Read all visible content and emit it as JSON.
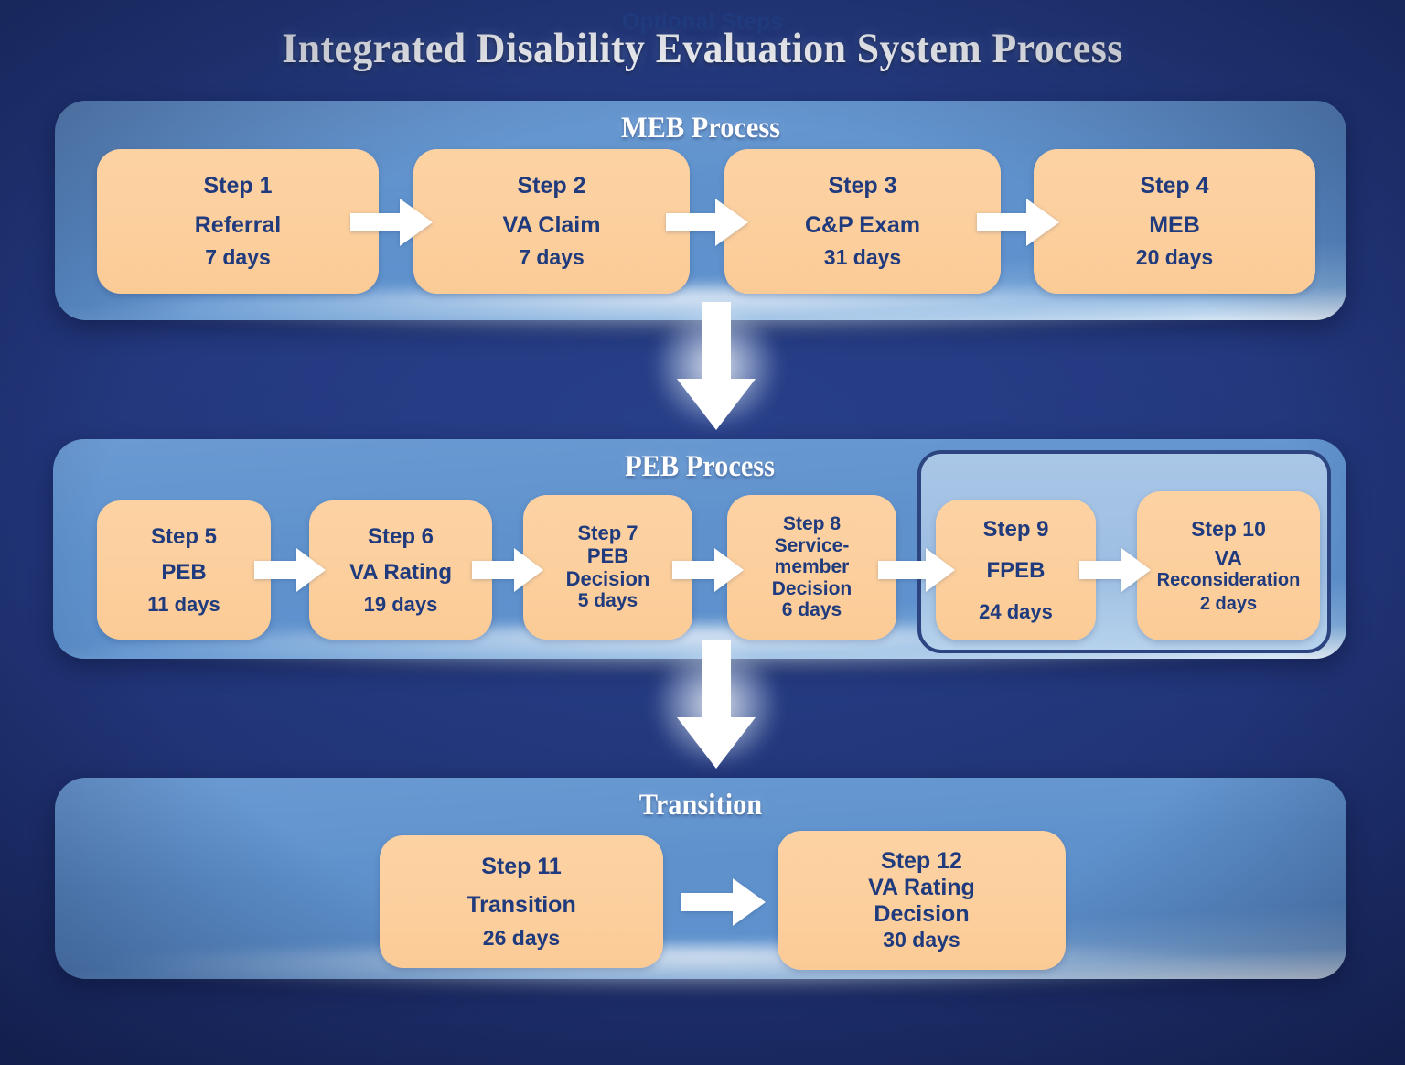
{
  "title": "Integrated Disability Evaluation System Process",
  "colors": {
    "background": "#1f3270",
    "panel": "#5f92cd",
    "card": "#fccf9d",
    "text": "#1f3a7d",
    "heading": "#ffffff",
    "optional_border": "#2c447f",
    "optional_fill": "#a9c6e6",
    "arrow": "#ffffff"
  },
  "sections": [
    {
      "id": "meb",
      "heading": "MEB Process",
      "steps": [
        {
          "number": "Step 1",
          "name": "Referral",
          "duration": "7 days"
        },
        {
          "number": "Step 2",
          "name": "VA Claim",
          "duration": "7 days"
        },
        {
          "number": "Step 3",
          "name": "C&P Exam",
          "duration": "31 days"
        },
        {
          "number": "Step 4",
          "name": "MEB",
          "duration": "20 days"
        }
      ]
    },
    {
      "id": "peb",
      "heading": "PEB Process",
      "steps": [
        {
          "number": "Step 5",
          "name": "PEB",
          "duration": "11 days"
        },
        {
          "number": "Step 6",
          "name": "VA Rating",
          "duration": "19 days"
        },
        {
          "number": "Step 7",
          "name_line1": "PEB",
          "name_line2": "Decision",
          "duration": "5 days"
        },
        {
          "number": "Step 8",
          "name_line1": "Service-",
          "name_line2": "member",
          "name_line3": "Decision",
          "duration": "6 days"
        }
      ],
      "optional": {
        "heading": "Optional Steps",
        "steps": [
          {
            "number": "Step 9",
            "name": "FPEB",
            "duration": "24 days"
          },
          {
            "number": "Step 10",
            "name_line1": "VA",
            "name_line2": "Reconsideration",
            "duration": "2 days"
          }
        ]
      }
    },
    {
      "id": "transition",
      "heading": "Transition",
      "steps": [
        {
          "number": "Step 11",
          "name": "Transition",
          "duration": "26 days"
        },
        {
          "number": "Step 12",
          "name_line1": "VA Rating",
          "name_line2": "Decision",
          "duration": "30 days"
        }
      ]
    }
  ],
  "arrows": {
    "horizontal_count": 8,
    "vertical_count": 2,
    "direction_horizontal": "right",
    "direction_vertical": "down"
  }
}
